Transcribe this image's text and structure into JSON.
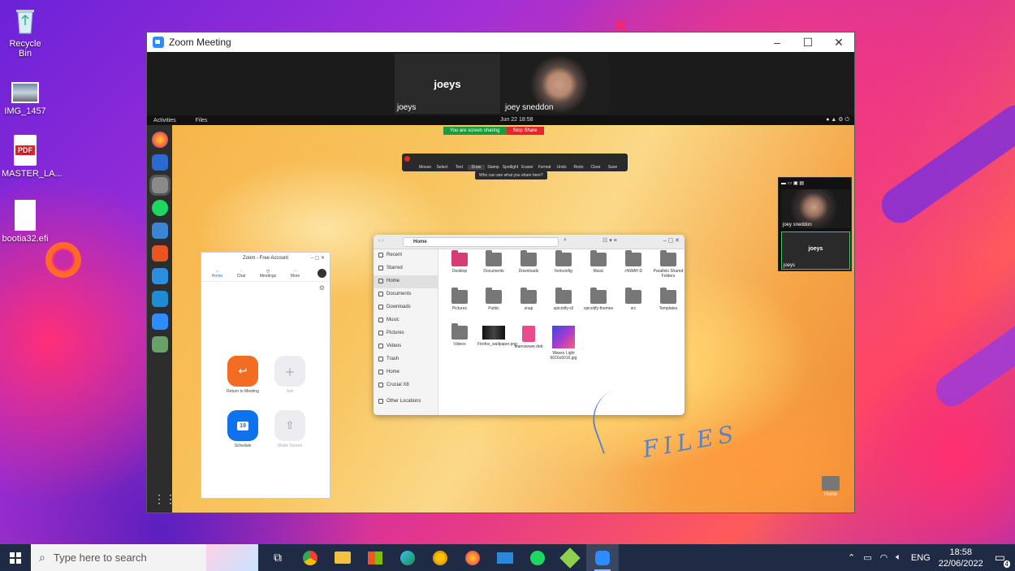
{
  "desktop": {
    "icons": [
      {
        "label": "Recycle Bin",
        "icon": "recycle-bin-icon"
      },
      {
        "label": "IMG_1457",
        "icon": "image-file-icon"
      },
      {
        "label": "MASTER_LA...",
        "icon": "pdf-file-icon",
        "badge": "PDF"
      },
      {
        "label": "bootia32.efi",
        "icon": "file-icon"
      }
    ]
  },
  "zoom_window": {
    "title": "Zoom Meeting",
    "controls": {
      "minimize": "–",
      "maximize": "☐",
      "close": "✕"
    },
    "participants": [
      {
        "display": "joeys",
        "name": "joeys"
      },
      {
        "name": "joey sneddon"
      }
    ]
  },
  "shared_screen": {
    "topbar": {
      "activities": "Activities",
      "files": "Files",
      "clock": "Jun 22  18:58"
    },
    "share_banner": {
      "status": "You are screen sharing",
      "stop": "Stop Share"
    },
    "annotation_tools": [
      "Mouse",
      "Select",
      "Text",
      "Draw",
      "Stamp",
      "Spotlight",
      "Eraser",
      "Format",
      "Undo",
      "Redo",
      "Clear",
      "Save"
    ],
    "active_tool": "Draw",
    "tooltip": "Who can see what you share here?",
    "floating_panel": {
      "video_name": "joey sneddon",
      "tile_display": "joeys",
      "tile_name": "joeys"
    },
    "annotation_text": "FILES",
    "desktop_home_label": "Home"
  },
  "zoom_free": {
    "title": "Zoom - Free Account",
    "nav": [
      "Home",
      "Chat",
      "Meetings",
      "More"
    ],
    "actions": [
      {
        "label": "Return to Meeting",
        "icon": "return-arrow-icon",
        "color": "#f26d21"
      },
      {
        "label": "Join",
        "icon": "plus-icon",
        "color": "#ececf1"
      },
      {
        "label": "Schedule",
        "icon": "calendar-icon",
        "color": "#0e72ed",
        "day": "19"
      },
      {
        "label": "Share Screen",
        "icon": "share-up-arrow-icon",
        "color": "#ececf1"
      }
    ]
  },
  "files_app": {
    "path": "Home",
    "sidebar": [
      "Recent",
      "Starred",
      "Home",
      "Documents",
      "Downloads",
      "Music",
      "Pictures",
      "Videos",
      "Trash",
      "Home",
      "Crucial X8",
      "Other Locations"
    ],
    "selected": "Home",
    "items": [
      {
        "name": "Desktop",
        "kind": "pink-folder"
      },
      {
        "name": "Documents",
        "kind": "folder"
      },
      {
        "name": "Downloads",
        "kind": "folder"
      },
      {
        "name": "fontconfig",
        "kind": "folder"
      },
      {
        "name": "Music",
        "kind": "folder"
      },
      {
        "name": ">NWAY-D",
        "kind": "folder"
      },
      {
        "name": "Parallels Shared Folders",
        "kind": "folder"
      },
      {
        "name": "Pictures",
        "kind": "folder"
      },
      {
        "name": "Public",
        "kind": "folder"
      },
      {
        "name": "snap",
        "kind": "folder"
      },
      {
        "name": "spicetify-cli",
        "kind": "folder"
      },
      {
        "name": "spicetify-themes",
        "kind": "folder"
      },
      {
        "name": "src",
        "kind": "folder"
      },
      {
        "name": "Templates",
        "kind": "folder"
      },
      {
        "name": "Videos",
        "kind": "folder"
      },
      {
        "name": "Firefox_wallpaper.png",
        "kind": "image-dark"
      },
      {
        "name": "teamviewer.deb",
        "kind": "package"
      },
      {
        "name": "Waves Light 6016x6016.jpg",
        "kind": "image-wave"
      }
    ]
  },
  "taskbar": {
    "search_placeholder": "Type here to search",
    "apps": [
      "task-view-icon",
      "chrome-icon",
      "file-explorer-icon",
      "store-icon",
      "edge-icon",
      "norton-icon",
      "firefox-icon",
      "mail-icon",
      "spotify-icon",
      "parallels-icon",
      "zoom-icon"
    ],
    "active_app": "zoom-icon",
    "language": "ENG",
    "time": "18:58",
    "date": "22/06/2022",
    "notification_count": "4"
  }
}
